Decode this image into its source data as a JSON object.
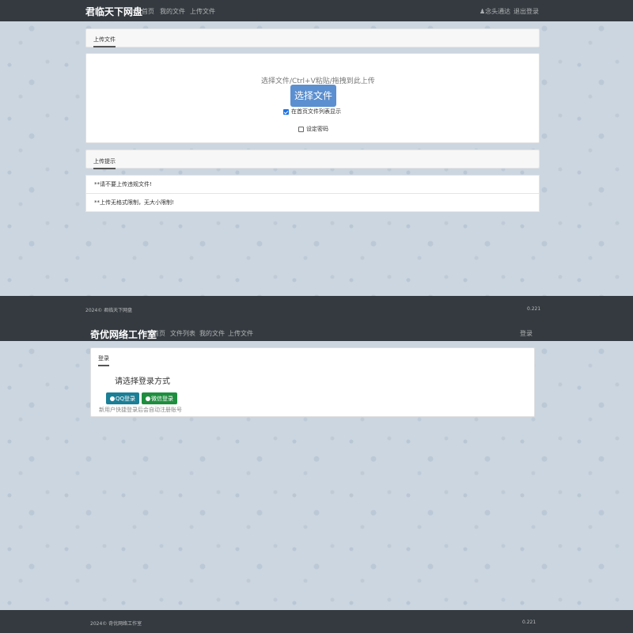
{
  "site1": {
    "brand": "君临天下网盘",
    "nav": [
      "首页",
      "我的文件",
      "上传文件"
    ],
    "user_label": "♟念头通达",
    "logout": "退出登录",
    "upload_tab": "上传文件",
    "upload_hint": "选择文件/Ctrl+V粘贴/拖拽到此上传",
    "choose_button": "选择文件",
    "show_on_home_label": "在首页文件列表显示",
    "show_on_home_checked": true,
    "set_password_label": "设定密码",
    "set_password_checked": false,
    "tips_tab": "上传提示",
    "tips": [
      "**请不要上传违规文件!",
      "**上传无格式限制，无大小限制!"
    ],
    "footer_left": "2024© 君临天下网盘",
    "footer_right": "0.221"
  },
  "site2": {
    "brand": "奇优网络工作室",
    "nav": [
      "首页",
      "文件列表",
      "我的文件",
      "上传文件"
    ],
    "login_link": "登录",
    "login_tab": "登录",
    "login_prompt": "请选择登录方式",
    "qq_button": "QQ登录",
    "wechat_button": "微信登录",
    "note": "新用户快捷登录后会自动注册账号",
    "footer_left": "2024© 奇优网络工作室",
    "footer_right": "0.221"
  },
  "colors": {
    "navbar": "#343a40",
    "primary": "#5b8fd0",
    "qq": "#1b7f96",
    "wechat": "#1e8e3e"
  }
}
